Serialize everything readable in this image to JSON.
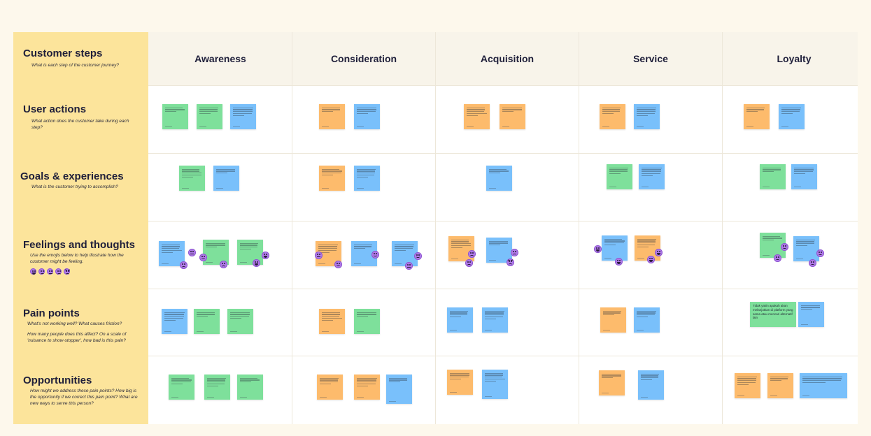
{
  "colors": {
    "background": "#fdf8ec",
    "step_column": "#fce49b",
    "note_green": "#7ee09b",
    "note_blue": "#79c0fb",
    "note_orange": "#fdbb6c",
    "emoji": "#b07be9"
  },
  "stages": [
    "Awareness",
    "Consideration",
    "Acquisition",
    "Service",
    "Loyalty"
  ],
  "steps": [
    {
      "title": "Customer steps",
      "description": "What is each step of the customer journey?"
    },
    {
      "title": "User actions",
      "description": "What action does the customer take during each step?"
    },
    {
      "title": "Goals & experiences",
      "description": "What is the customer trying to accomplish?"
    },
    {
      "title": "Feelings and thoughts",
      "description": "Use the emojis below to help illustrate how the customer might be feeling."
    },
    {
      "title": "Pain points",
      "description": "What's not working well? What causes friction?",
      "description2": "How many people does this affect? On a scale of 'nuisance to show-stopper', how bad is this pain?"
    },
    {
      "title": "Opportunities",
      "description": "How might we address these pain points? How big is the opportunity if we correct this pain point? What are new ways to serve this person?"
    }
  ],
  "legend_emojis": [
    "happy",
    "smile",
    "neutral",
    "sad",
    "angry"
  ],
  "notes": {
    "loyalty_pain_large": "Tidak yakin apakah akan melanjutkan di platform yang sama atau mencari alternatif lain"
  }
}
